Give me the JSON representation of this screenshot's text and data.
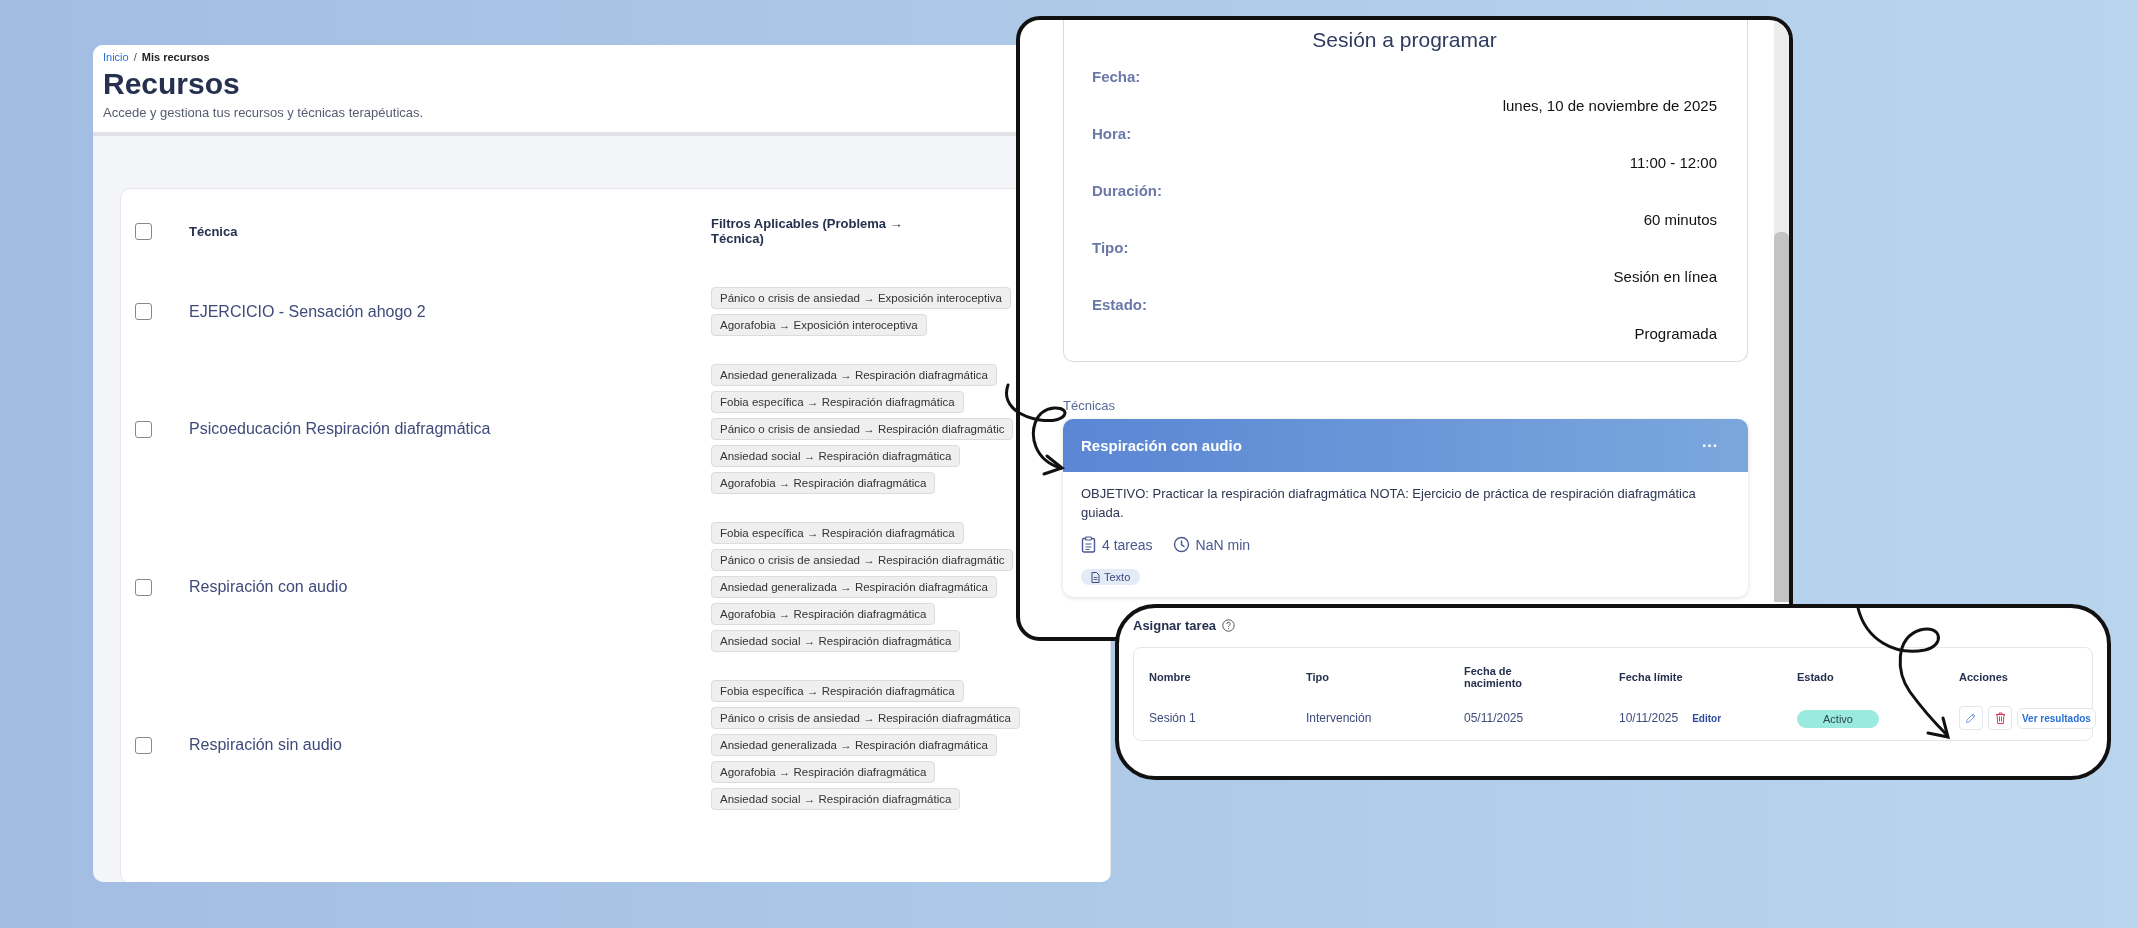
{
  "breadcrumb": [
    {
      "label": "Inicio",
      "kind": "link"
    },
    {
      "label": "Mis recursos",
      "kind": "current"
    }
  ],
  "breadcrumb_separator": "/",
  "page": {
    "title": "Recursos",
    "subtitle": "Accede y gestiona tus recursos y técnicas terapéuticas."
  },
  "resources_table": {
    "columns": [
      "Técnica",
      "Filtros Aplicables (Problema → Técnica)"
    ],
    "header_checked": false,
    "rows": [
      {
        "checked": false,
        "name": "EJERCICIO - Sensación ahogo 2",
        "filters": [
          "Pánico o crisis de ansiedad → Exposición interoceptiva",
          "Agorafobia → Exposición interoceptiva"
        ]
      },
      {
        "checked": false,
        "name": "Psicoeducación Respiración diafragmática",
        "filters": [
          "Ansiedad generalizada → Respiración diafragmática",
          "Fobia específica → Respiración diafragmática",
          "Pánico o crisis de ansiedad → Respiración diafragmátic",
          "Ansiedad social → Respiración diafragmática",
          "Agorafobia → Respiración diafragmática"
        ]
      },
      {
        "checked": false,
        "name": "Respiración con audio",
        "filters": [
          "Fobia específica → Respiración diafragmática",
          "Pánico o crisis de ansiedad → Respiración diafragmátic",
          "Ansiedad generalizada → Respiración diafragmática",
          "Agorafobia → Respiración diafragmática",
          "Ansiedad social → Respiración diafragmática"
        ]
      },
      {
        "checked": false,
        "name": "Respiración sin audio",
        "filters": [
          "Fobia específica → Respiración diafragmática",
          "Pánico o crisis de ansiedad → Respiración diafragmática",
          "Ansiedad generalizada → Respiración diafragmática",
          "Agorafobia → Respiración diafragmática",
          "Ansiedad social → Respiración diafragmática"
        ]
      }
    ]
  },
  "session_panel": {
    "title": "Sesión a programar",
    "fields": [
      {
        "label": "Fecha:",
        "value": "lunes, 10 de noviembre de 2025"
      },
      {
        "label": "Hora:",
        "value": "11:00 - 12:00"
      },
      {
        "label": "Duración:",
        "value": "60 minutos"
      },
      {
        "label": "Tipo:",
        "value": "Sesión en línea"
      },
      {
        "label": "Estado:",
        "value": "Programada"
      }
    ],
    "section_label": "Técnicas",
    "technique": {
      "title": "Respiración con audio",
      "menu": "···",
      "description": "OBJETIVO: Practicar la respiración diafragmática NOTA: Ejercicio de práctica de respiración diafragmática guiada.",
      "tasks": "4 tareas",
      "duration": "NaN min",
      "tags": [
        "Texto"
      ]
    }
  },
  "assign_panel": {
    "title": "Asignar tarea",
    "columns": [
      "Nombre",
      "Tipo",
      "Fecha de nacimiento",
      "Fecha límite",
      "Estado",
      "Acciones"
    ],
    "rows": [
      {
        "cells": [
          "Sesión 1",
          "Intervención",
          "05/11/2025",
          "10/11/2025"
        ],
        "author": "Editor",
        "status": "Activo",
        "actions": [
          "Ver resultados"
        ]
      }
    ]
  }
}
